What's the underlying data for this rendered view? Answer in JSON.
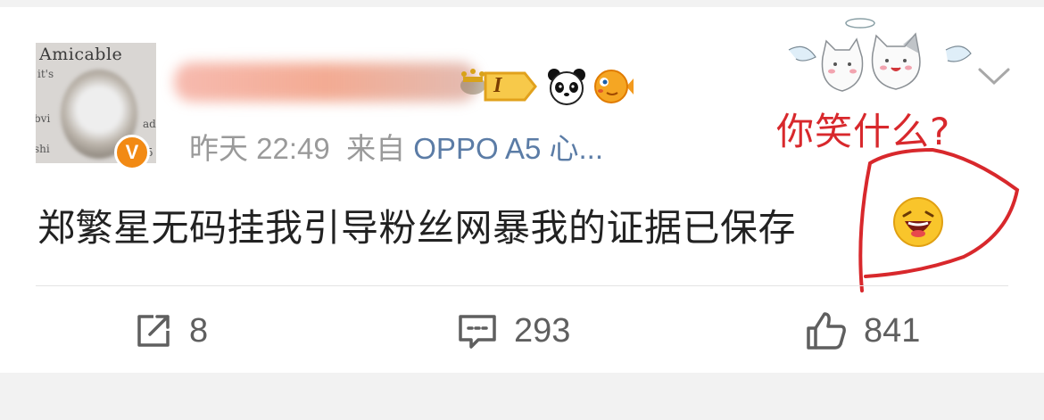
{
  "post": {
    "author_name": "",
    "level_badge": "I",
    "timestamp": "昨天 22:49",
    "source_prefix": "来自",
    "source_device": "OPPO A5 心...",
    "text": "郑繁星无码挂我引导粉丝网暴我的证据已保存",
    "avatar_watermark": "Amicable",
    "avatar_side_top": "it's",
    "avatar_side_mid": "bvi",
    "avatar_side_ad": "ad",
    "avatar_side_shi": "shi",
    "avatar_side_num": "5",
    "verified_mark": "V"
  },
  "annotation": {
    "handwritten_text": "你笑什么?",
    "color": "#d8282c"
  },
  "actions": {
    "repost_count": "8",
    "comment_count": "293",
    "like_count": "841"
  },
  "icons": {
    "more": "chevron-down-icon",
    "repost": "share-square-icon",
    "comment": "comment-bubble-icon",
    "like": "thumbs-up-icon",
    "emoji_inline": "laughing-face-icon"
  },
  "colors": {
    "background": "#f2f2f2",
    "card": "#ffffff",
    "meta_gray": "#9a9a9a",
    "source_blue": "#5b7ca6",
    "verified_orange": "#f28a14"
  }
}
